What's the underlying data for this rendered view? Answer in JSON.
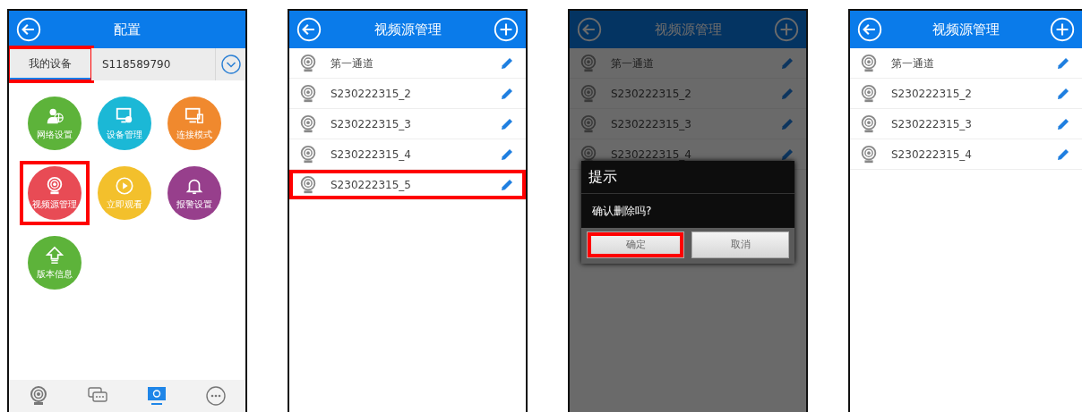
{
  "screens": [
    {
      "kind": "config",
      "title": "配置",
      "dimmed": false,
      "tabs": [
        {
          "label": "我的设备",
          "selected": true,
          "highlighted": true
        },
        {
          "label": "S118589790",
          "selected": false,
          "highlighted": false
        }
      ],
      "tiles": [
        {
          "label": "网络设置",
          "kind": "network",
          "color": "#5db33a",
          "highlighted": false
        },
        {
          "label": "设备管理",
          "kind": "device",
          "color": "#1bb8d6",
          "highlighted": false
        },
        {
          "label": "连接模式",
          "kind": "connect",
          "color": "#f0892e",
          "highlighted": false
        },
        {
          "label": "视频源管理",
          "kind": "camera",
          "color": "#e84b55",
          "highlighted": true
        },
        {
          "label": "立即观看",
          "kind": "play",
          "color": "#f3c02c",
          "highlighted": false
        },
        {
          "label": "报警设置",
          "kind": "bell",
          "color": "#973f8c",
          "highlighted": false
        },
        {
          "label": "版本信息",
          "kind": "upgrade",
          "color": "#5db33a",
          "highlighted": false
        }
      ],
      "bottom_nav": [
        {
          "kind": "camera",
          "selected": false
        },
        {
          "kind": "chat",
          "selected": false
        },
        {
          "kind": "monitor",
          "selected": true
        },
        {
          "kind": "more",
          "selected": false
        }
      ]
    },
    {
      "kind": "list",
      "title": "视频源管理",
      "dimmed": false,
      "items": [
        {
          "label": "第一通道",
          "highlighted": false
        },
        {
          "label": "S230222315_2",
          "highlighted": false
        },
        {
          "label": "S230222315_3",
          "highlighted": false
        },
        {
          "label": "S230222315_4",
          "highlighted": false
        },
        {
          "label": "S230222315_5",
          "highlighted": true
        }
      ]
    },
    {
      "kind": "list",
      "title": "视频源管理",
      "dimmed": true,
      "items": [
        {
          "label": "第一通道",
          "highlighted": false
        },
        {
          "label": "S230222315_2",
          "highlighted": false
        },
        {
          "label": "S230222315_3",
          "highlighted": false
        },
        {
          "label": "S230222315_4",
          "highlighted": false
        }
      ],
      "dialog": {
        "title": "提示",
        "message": "确认删除吗?",
        "buttons": [
          {
            "label": "确定",
            "highlighted": true
          },
          {
            "label": "取消",
            "highlighted": false
          }
        ]
      }
    },
    {
      "kind": "list",
      "title": "视频源管理",
      "dimmed": false,
      "items": [
        {
          "label": "第一通道",
          "highlighted": false
        },
        {
          "label": "S230222315_2",
          "highlighted": false
        },
        {
          "label": "S230222315_3",
          "highlighted": false
        },
        {
          "label": "S230222315_4",
          "highlighted": false
        }
      ]
    }
  ]
}
